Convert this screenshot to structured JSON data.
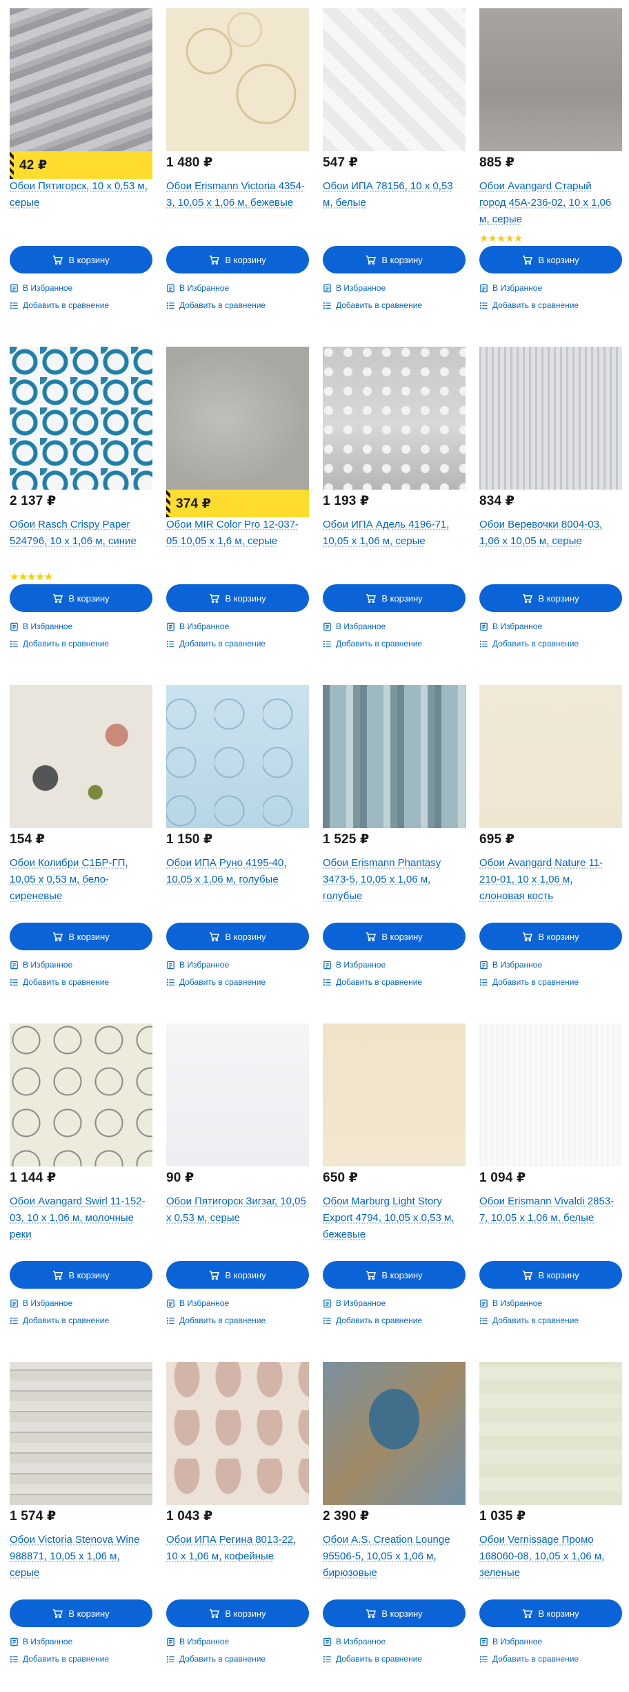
{
  "currency": "₽",
  "labels": {
    "cart": "В корзину",
    "favorites": "В Избранное",
    "compare": "Добавить в сравнение"
  },
  "colors": {
    "accent": "#0b63d8",
    "link": "#0066cc",
    "promo": "#ffdc2e",
    "stars": "#ffcc00"
  },
  "products": [
    {
      "price": "42 ₽",
      "promo": true,
      "title": "Обои Пятигорск, 10 х 0,53 м, серые",
      "stars": ""
    },
    {
      "price": "1 480 ₽",
      "promo": false,
      "title": "Обои Erismann Victoria 4354-3, 10,05 х 1,06 м, бежевые",
      "stars": ""
    },
    {
      "price": "547 ₽",
      "promo": false,
      "title": "Обои ИПА 78156, 10 х 0,53 м, белые",
      "stars": ""
    },
    {
      "price": "885 ₽",
      "promo": false,
      "title": "Обои Avangard Старый город 45А-236-02, 10 х 1,06 м, серые",
      "stars": "★★★★★"
    },
    {
      "price": "2 137 ₽",
      "promo": false,
      "title": "Обои Rasch Crispy Paper 524796, 10 х 1,06 м, синие",
      "stars": "★★★★★"
    },
    {
      "price": "374 ₽",
      "promo": true,
      "title": "Обои MIR Color Pro 12-037-05 10,05 х 1,6 м, серые",
      "stars": ""
    },
    {
      "price": "1 193 ₽",
      "promo": false,
      "title": "Обои ИПА Адель 4196-71, 10,05 х 1,06 м, серые",
      "stars": ""
    },
    {
      "price": "834 ₽",
      "promo": false,
      "title": "Обои Веревочки 8004-03, 1,06 х 10,05 м, серые",
      "stars": ""
    },
    {
      "price": "154 ₽",
      "promo": false,
      "title": "Обои Колибри С1БР-ГП, 10,05 х 0,53 м, бело-сиреневые",
      "stars": ""
    },
    {
      "price": "1 150 ₽",
      "promo": false,
      "title": "Обои ИПА Руно 4195-40, 10,05 х 1,06 м, голубые",
      "stars": ""
    },
    {
      "price": "1 525 ₽",
      "promo": false,
      "title": "Обои Erismann Phantasy 3473-5, 10,05 х 1,06 м, голубые",
      "stars": ""
    },
    {
      "price": "695 ₽",
      "promo": false,
      "title": "Обои Avangard Nature 11-210-01, 10 х 1,06 м, слоновая кость",
      "stars": ""
    },
    {
      "price": "1 144 ₽",
      "promo": false,
      "title": "Обои Avangard Swirl 11-152-03, 10 х 1,06 м, молочные реки",
      "stars": ""
    },
    {
      "price": "90 ₽",
      "promo": false,
      "title": "Обои Пятигорск Зигзаг, 10,05 х 0,53 м, серые",
      "stars": ""
    },
    {
      "price": "650 ₽",
      "promo": false,
      "title": "Обои Marburg Light Story Export 4794, 10,05 х 0,53 м, бежевые",
      "stars": ""
    },
    {
      "price": "1 094 ₽",
      "promo": false,
      "title": "Обои Erismann Vivaldi 2853-7, 10,05 х 1,06 м, белые",
      "stars": ""
    },
    {
      "price": "1 574 ₽",
      "promo": false,
      "title": "Обои Victoria Stenova Wine 988871, 10,05 х 1,06 м, серые",
      "stars": ""
    },
    {
      "price": "1 043 ₽",
      "promo": false,
      "title": "Обои ИПА Регина 8013-22, 10 х 1,06 м, кофейные",
      "stars": ""
    },
    {
      "price": "2 390 ₽",
      "promo": false,
      "title": "Обои A.S. Creation Lounge 95506-5, 10,05 х 1,06 м, бирюзовые",
      "stars": ""
    },
    {
      "price": "1 035 ₽",
      "promo": false,
      "title": "Обои Vernissage Промо 168060-08, 10,05 х 1,06 м, зеленые",
      "stars": ""
    }
  ]
}
